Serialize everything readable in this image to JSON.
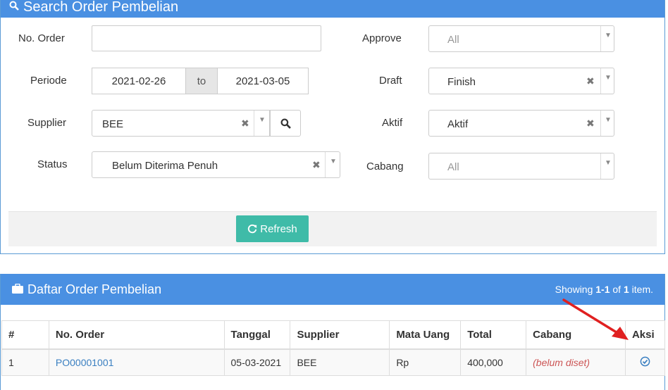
{
  "search": {
    "title": "Search Order Pembelian",
    "labels": {
      "no_order": "No. Order",
      "periode": "Periode",
      "supplier": "Supplier",
      "status": "Status",
      "approve": "Approve",
      "draft": "Draft",
      "aktif": "Aktif",
      "cabang": "Cabang"
    },
    "no_order_value": "",
    "date_from": "2021-02-26",
    "date_to_label": "to",
    "date_to": "2021-03-05",
    "supplier_value": "BEE",
    "status_value": "Belum Diterima Penuh",
    "approve_value": "All",
    "draft_value": "Finish",
    "aktif_value": "Aktif",
    "cabang_value": "All",
    "refresh_label": "Refresh"
  },
  "list": {
    "title": "Daftar Order Pembelian",
    "summary_prefix": "Showing ",
    "summary_range": "1-1",
    "summary_mid": " of ",
    "summary_total": "1",
    "summary_suffix": " item.",
    "columns": [
      "#",
      "No. Order",
      "Tanggal",
      "Supplier",
      "Mata Uang",
      "Total",
      "Cabang",
      "Aksi"
    ],
    "rows": [
      {
        "num": "1",
        "no_order": "PO00001001",
        "tanggal": "05-03-2021",
        "supplier": "BEE",
        "mata_uang": "Rp",
        "total": "400,000",
        "cabang": "(belum diset)",
        "aksi_icon": "check-circle-icon"
      }
    ]
  },
  "colors": {
    "header_blue": "#4a90e2",
    "refresh_teal": "#3fbba8",
    "annotation_red": "#e02020"
  }
}
